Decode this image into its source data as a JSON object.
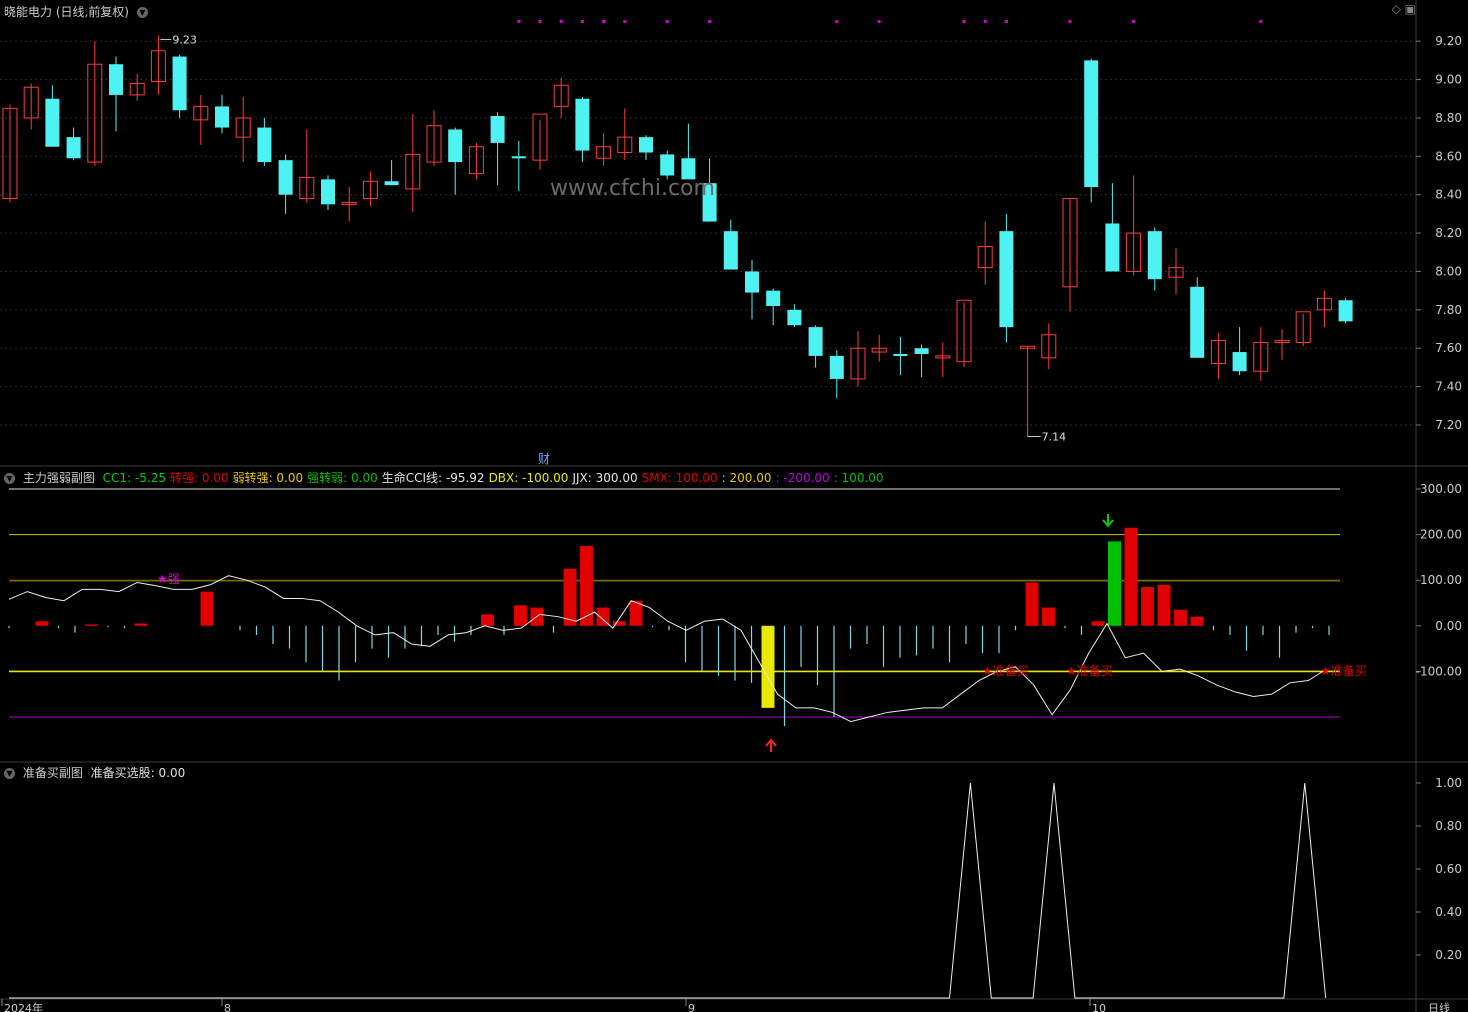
{
  "header": {
    "title": "晓能电力 (日线,前复权)",
    "settings_icon": "collapse-icon",
    "tool_icons": [
      "diamond-icon",
      "window-icon"
    ]
  },
  "watermark": "www.cfchi.com",
  "colors": {
    "up": "#ff3b3b",
    "down": "#4ff2f2",
    "bg": "#000000",
    "grid": "#2b2b2b",
    "red": "#e00000",
    "green": "#00c000",
    "yellow": "#e8e800",
    "purple": "#b000d0",
    "white": "#ffffff",
    "cyan_thin": "#7fd8e0"
  },
  "price_axis": {
    "ticks": [
      "9.20",
      "9.00",
      "8.80",
      "8.60",
      "8.40",
      "8.20",
      "8.00",
      "7.80",
      "7.60",
      "7.40",
      "7.20"
    ]
  },
  "annotations": {
    "high": "9.23",
    "low": "7.14",
    "cai": "财"
  },
  "indicator": {
    "name": "主力强弱副图",
    "items": [
      {
        "label": "CC1: -5.25",
        "color": "#00d000"
      },
      {
        "label": "转强: 0.00",
        "color": "#e00000"
      },
      {
        "label": "弱转强: 0.00",
        "color": "#e8c800"
      },
      {
        "label": "强转弱: 0.00",
        "color": "#00c000"
      },
      {
        "label": "生命CCI线: -95.92",
        "color": "#e0e0e0"
      },
      {
        "label": "DBX: -100.00",
        "color": "#e8e800"
      },
      {
        "label": "JJX: 300.00",
        "color": "#e0e0e0"
      },
      {
        "label": "SMX: 100.00",
        "color": "#e00000"
      },
      {
        "label": ": 200.00",
        "color": "#e8c800"
      },
      {
        "label": ": -200.00",
        "color": "#c000e0"
      },
      {
        "label": ": 100.00",
        "color": "#00c000"
      }
    ],
    "axis_ticks": [
      "300.00",
      "200.00",
      "100.00",
      "0.00",
      "-100.00"
    ],
    "marks": {
      "qiang": "★强",
      "buy": "★准备买"
    }
  },
  "prep": {
    "name": "准备买副图",
    "items": [
      {
        "label": "准备买选股: 0.00",
        "color": "#e0e0e0"
      }
    ],
    "axis_ticks": [
      "1.00",
      "0.80",
      "0.60",
      "0.40",
      "0.20"
    ]
  },
  "date_axis": {
    "labels": [
      "2024年",
      "8",
      "9",
      "10"
    ],
    "period": "日线"
  },
  "chart_data": [
    {
      "type": "candlestick",
      "title": "晓能电力 (日线,前复权)",
      "ylim": [
        7.08,
        9.3
      ],
      "candles": [
        [
          8.38,
          8.87,
          8.36,
          8.85
        ],
        [
          8.8,
          8.98,
          8.74,
          8.96
        ],
        [
          8.9,
          8.97,
          8.65,
          8.65
        ],
        [
          8.7,
          8.75,
          8.58,
          8.59
        ],
        [
          8.57,
          9.2,
          8.55,
          9.08
        ],
        [
          9.08,
          9.12,
          8.73,
          8.92
        ],
        [
          8.92,
          9.03,
          8.89,
          8.98
        ],
        [
          8.99,
          9.23,
          8.92,
          9.15
        ],
        [
          9.12,
          9.13,
          8.8,
          8.84
        ],
        [
          8.79,
          8.92,
          8.66,
          8.86
        ],
        [
          8.86,
          8.92,
          8.72,
          8.75
        ],
        [
          8.7,
          8.91,
          8.57,
          8.8
        ],
        [
          8.75,
          8.8,
          8.55,
          8.57
        ],
        [
          8.58,
          8.61,
          8.3,
          8.4
        ],
        [
          8.38,
          8.74,
          8.36,
          8.49
        ],
        [
          8.48,
          8.5,
          8.32,
          8.35
        ],
        [
          8.35,
          8.44,
          8.26,
          8.36
        ],
        [
          8.38,
          8.52,
          8.34,
          8.47
        ],
        [
          8.47,
          8.58,
          8.45,
          8.45
        ],
        [
          8.43,
          8.82,
          8.31,
          8.61
        ],
        [
          8.57,
          8.84,
          8.55,
          8.76
        ],
        [
          8.74,
          8.75,
          8.4,
          8.57
        ],
        [
          8.51,
          8.67,
          8.48,
          8.65
        ],
        [
          8.81,
          8.83,
          8.45,
          8.67
        ],
        [
          8.6,
          8.68,
          8.42,
          8.59
        ],
        [
          8.58,
          8.79,
          8.53,
          8.82
        ],
        [
          8.86,
          9.01,
          8.8,
          8.97
        ],
        [
          8.9,
          8.91,
          8.57,
          8.63
        ],
        [
          8.59,
          8.72,
          8.55,
          8.65
        ],
        [
          8.62,
          8.85,
          8.58,
          8.7
        ],
        [
          8.7,
          8.71,
          8.58,
          8.62
        ],
        [
          8.61,
          8.63,
          8.48,
          8.5
        ],
        [
          8.59,
          8.77,
          8.48,
          8.48
        ],
        [
          8.46,
          8.59,
          8.3,
          8.26
        ],
        [
          8.21,
          8.27,
          8.05,
          8.01
        ],
        [
          8.0,
          8.06,
          7.75,
          7.89
        ],
        [
          7.9,
          7.91,
          7.72,
          7.82
        ],
        [
          7.8,
          7.83,
          7.71,
          7.72
        ],
        [
          7.71,
          7.72,
          7.5,
          7.56
        ],
        [
          7.56,
          7.59,
          7.34,
          7.44
        ],
        [
          7.44,
          7.69,
          7.4,
          7.6
        ],
        [
          7.58,
          7.67,
          7.53,
          7.6
        ],
        [
          7.57,
          7.66,
          7.46,
          7.56
        ],
        [
          7.6,
          7.62,
          7.45,
          7.57
        ],
        [
          7.56,
          7.63,
          7.45,
          7.56
        ],
        [
          7.53,
          7.84,
          7.5,
          7.85
        ],
        [
          8.02,
          8.26,
          7.93,
          8.13
        ],
        [
          8.21,
          8.3,
          7.63,
          7.71
        ],
        [
          7.61,
          7.61,
          7.14,
          7.61
        ],
        [
          7.55,
          7.73,
          7.49,
          7.67
        ],
        [
          7.92,
          8.38,
          7.79,
          8.38
        ],
        [
          9.1,
          9.11,
          8.36,
          8.44
        ],
        [
          8.25,
          8.46,
          8.07,
          8.0
        ],
        [
          8.0,
          8.5,
          7.98,
          8.2
        ],
        [
          8.21,
          8.23,
          7.9,
          7.96
        ],
        [
          7.97,
          8.12,
          7.88,
          8.02
        ],
        [
          7.92,
          7.97,
          7.56,
          7.55
        ],
        [
          7.52,
          7.68,
          7.44,
          7.64
        ],
        [
          7.58,
          7.71,
          7.46,
          7.48
        ],
        [
          7.48,
          7.71,
          7.43,
          7.63
        ],
        [
          7.64,
          7.7,
          7.54,
          7.64
        ],
        [
          7.63,
          7.78,
          7.61,
          7.79
        ],
        [
          7.8,
          7.9,
          7.71,
          7.86
        ],
        [
          7.85,
          7.86,
          7.73,
          7.74
        ]
      ]
    },
    {
      "type": "bar+line",
      "title": "主力强弱副图",
      "ylim": [
        -290,
        300
      ],
      "bars": [
        -5,
        0,
        10,
        -5,
        -15,
        3,
        -3,
        -5,
        5,
        0,
        0,
        0,
        75,
        0,
        -10,
        -20,
        -40,
        -50,
        -80,
        -100,
        -120,
        -80,
        -50,
        -70,
        -50,
        -45,
        -20,
        -35,
        -20,
        25,
        -20,
        45,
        40,
        -15,
        125,
        175,
        40,
        10,
        55,
        -3,
        -10,
        -80,
        -100,
        -110,
        -120,
        -125,
        -180,
        -220,
        -90,
        -130,
        -200,
        -50,
        -40,
        -90,
        -70,
        -65,
        -50,
        -80,
        -40,
        -60,
        -60,
        -10,
        95,
        40,
        -5,
        -20,
        10,
        185,
        215,
        85,
        90,
        35,
        20,
        -10,
        -20,
        -55,
        -20,
        -70,
        -15,
        -5,
        -20
      ],
      "bar_colors": "red>0, cyan<0, yellow@index 35, green@index 51",
      "cci_line": [
        58,
        75,
        62,
        55,
        80,
        80,
        75,
        95,
        88,
        80,
        80,
        90,
        110,
        100,
        85,
        60,
        60,
        55,
        30,
        0,
        -20,
        -15,
        -40,
        -45,
        -20,
        -15,
        0,
        -10,
        -5,
        25,
        20,
        10,
        30,
        -5,
        55,
        40,
        10,
        -10,
        10,
        15,
        -10,
        -80,
        -150,
        -180,
        -180,
        -190,
        -210,
        -200,
        -190,
        -185,
        -180,
        -180,
        -150,
        -120,
        -100,
        -90,
        -130,
        -195,
        -140,
        -60,
        5,
        -70,
        -60,
        -100,
        -95,
        -110,
        -130,
        -145,
        -155,
        -150,
        -125,
        -120,
        -95
      ],
      "reference_lines": [
        300,
        200,
        100,
        -100,
        -200
      ]
    },
    {
      "type": "line",
      "title": "准备买副图",
      "ylim": [
        -0.03,
        1.05
      ],
      "values": [
        0,
        0,
        0,
        0,
        0,
        0,
        0,
        0,
        0,
        0,
        0,
        0,
        0,
        0,
        0,
        0,
        0,
        0,
        0,
        0,
        0,
        0,
        0,
        0,
        0,
        0,
        0,
        0,
        0,
        0,
        0,
        0,
        0,
        0,
        0,
        0,
        0,
        0,
        0,
        0,
        0,
        0,
        0,
        0,
        0,
        0,
        1,
        0,
        0,
        0,
        1,
        0,
        0,
        0,
        0,
        0,
        0,
        0,
        0,
        0,
        0,
        0,
        1,
        0
      ]
    }
  ]
}
